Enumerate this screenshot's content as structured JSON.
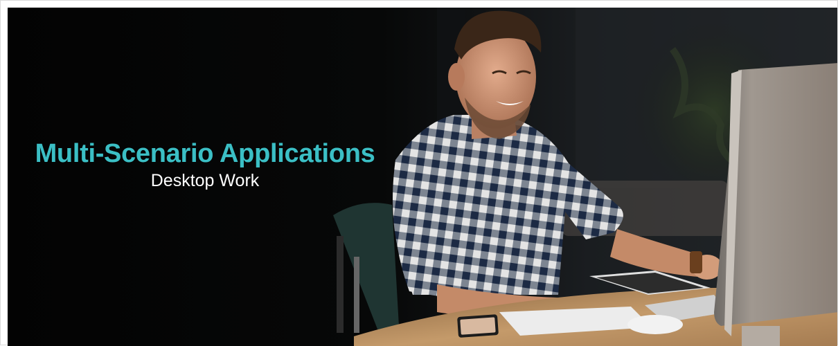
{
  "banner": {
    "title": "Multi-Scenario Applications",
    "subtitle": "Desktop Work",
    "image": "man-working-at-desktop-computer-photo"
  },
  "colors": {
    "title": "#3bbfc5",
    "subtitle": "#ffffff",
    "background": "#050505"
  }
}
